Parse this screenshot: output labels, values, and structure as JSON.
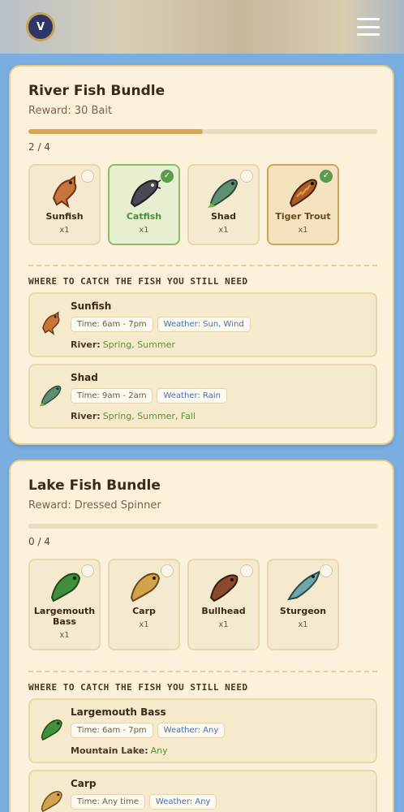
{
  "header": {
    "logo_letter": "V"
  },
  "bundles": [
    {
      "title": "River Fish Bundle",
      "reward_label": "Reward:",
      "reward_value": "30 Bait",
      "progress_text": "2 / 4",
      "progress_fraction": 0.5,
      "fish": [
        {
          "name": "Sunfish",
          "qty": "x1",
          "done": false
        },
        {
          "name": "Catfish",
          "qty": "x1",
          "done": true
        },
        {
          "name": "Shad",
          "qty": "x1",
          "done": false
        },
        {
          "name": "Tiger Trout",
          "qty": "x1",
          "done": true
        }
      ],
      "section_heading": "WHERE TO CATCH THE FISH YOU STILL NEED",
      "locations": [
        {
          "name": "Sunfish",
          "time": "Time: 6am - 7pm",
          "weather": "Weather: Sun, Wind",
          "where_label": "River:",
          "where_value": "Spring, Summer"
        },
        {
          "name": "Shad",
          "time": "Time: 9am - 2am",
          "weather": "Weather: Rain",
          "where_label": "River:",
          "where_value": "Spring, Summer, Fall"
        }
      ]
    },
    {
      "title": "Lake Fish Bundle",
      "reward_label": "Reward:",
      "reward_value": "Dressed Spinner",
      "progress_text": "0 / 4",
      "progress_fraction": 0,
      "fish": [
        {
          "name": "Largemouth Bass",
          "qty": "x1",
          "done": false
        },
        {
          "name": "Carp",
          "qty": "x1",
          "done": false
        },
        {
          "name": "Bullhead",
          "qty": "x1",
          "done": false
        },
        {
          "name": "Sturgeon",
          "qty": "x1",
          "done": false
        }
      ],
      "section_heading": "WHERE TO CATCH THE FISH YOU STILL NEED",
      "locations": [
        {
          "name": "Largemouth Bass",
          "time": "Time: 6am - 7pm",
          "weather": "Weather: Any",
          "where_label": "Mountain Lake:",
          "where_value": "Any"
        },
        {
          "name": "Carp",
          "time": "Time: Any time",
          "weather": "Weather: Any",
          "where_label": "",
          "where_value": ""
        }
      ]
    }
  ],
  "colors": {
    "sunfish": "#c8743a",
    "catfish": "#4a4a52",
    "shad": "#5f8f72",
    "tiger_trout": "#b05a2a",
    "largemouth_bass": "#3f8f3c",
    "carp": "#d4a24c",
    "bullhead": "#8a4a2c",
    "sturgeon": "#6fa7a8"
  }
}
